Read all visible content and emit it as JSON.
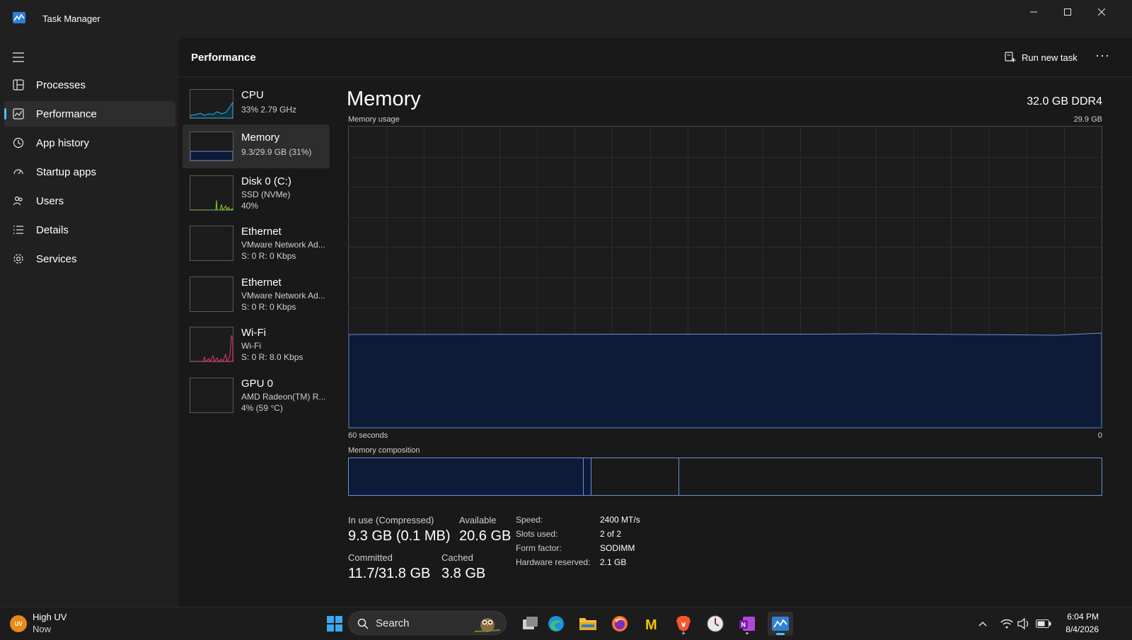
{
  "window": {
    "title": "Task Manager"
  },
  "nav": {
    "items": [
      {
        "label": "Processes"
      },
      {
        "label": "Performance"
      },
      {
        "label": "App history"
      },
      {
        "label": "Startup apps"
      },
      {
        "label": "Users"
      },
      {
        "label": "Details"
      },
      {
        "label": "Services"
      }
    ],
    "active": "Performance"
  },
  "header": {
    "title": "Performance",
    "run_task_label": "Run new task",
    "more_label": "···"
  },
  "resources": [
    {
      "name": "CPU",
      "line1": "33%  2.79 GHz",
      "line2": ""
    },
    {
      "name": "Memory",
      "line1": "9.3/29.9 GB (31%)",
      "line2": ""
    },
    {
      "name": "Disk 0 (C:)",
      "line1": "SSD (NVMe)",
      "line2": "40%"
    },
    {
      "name": "Ethernet",
      "line1": "VMware Network Ad...",
      "line2": "S: 0  R: 0 Kbps"
    },
    {
      "name": "Ethernet",
      "line1": "VMware Network Ad...",
      "line2": "S: 0  R: 0 Kbps"
    },
    {
      "name": "Wi-Fi",
      "line1": "Wi-Fi",
      "line2": "S: 0  R: 8.0 Kbps"
    },
    {
      "name": "GPU 0",
      "line1": "AMD Radeon(TM) R...",
      "line2": "4%  (59 °C)"
    }
  ],
  "detail": {
    "title": "Memory",
    "spec": "32.0 GB DDR4",
    "usage_label": "Memory usage",
    "usage_max": "29.9 GB",
    "time_left_label": "60 seconds",
    "time_right_label": "0",
    "composition_label": "Memory composition",
    "usage_fraction": 0.31,
    "composition": {
      "in_use_fraction": 0.311,
      "modified_fraction": 0.011,
      "standby_fraction": 0.117
    },
    "stats": {
      "in_use_label": "In use (Compressed)",
      "in_use_value": "9.3 GB (0.1 MB)",
      "available_label": "Available",
      "available_value": "20.6 GB",
      "committed_label": "Committed",
      "committed_value": "11.7/31.8 GB",
      "cached_label": "Cached",
      "cached_value": "3.8 GB"
    },
    "specs": [
      {
        "label": "Speed:",
        "value": "2400 MT/s"
      },
      {
        "label": "Slots used:",
        "value": "2 of 2"
      },
      {
        "label": "Form factor:",
        "value": "SODIMM"
      },
      {
        "label": "Hardware reserved:",
        "value": "2.1 GB"
      }
    ]
  },
  "taskbar": {
    "weather_badge": "UV",
    "weather_title": "High UV",
    "weather_sub": "Now",
    "search_placeholder": "Search",
    "apps": [
      "task-view",
      "edge",
      "file-explorer",
      "firefox",
      "m-app",
      "brave",
      "clock-app",
      "onenote",
      "task-manager"
    ],
    "time": "6:04 PM",
    "date": "8/4/2026"
  },
  "colors": {
    "accent": "#4cc2ff",
    "memory_line": "#6d8fd6",
    "memory_fill": "#0d1a38",
    "cpu": "#3ab0e0",
    "disk": "#7ec53a",
    "wifi": "#d63a79"
  }
}
